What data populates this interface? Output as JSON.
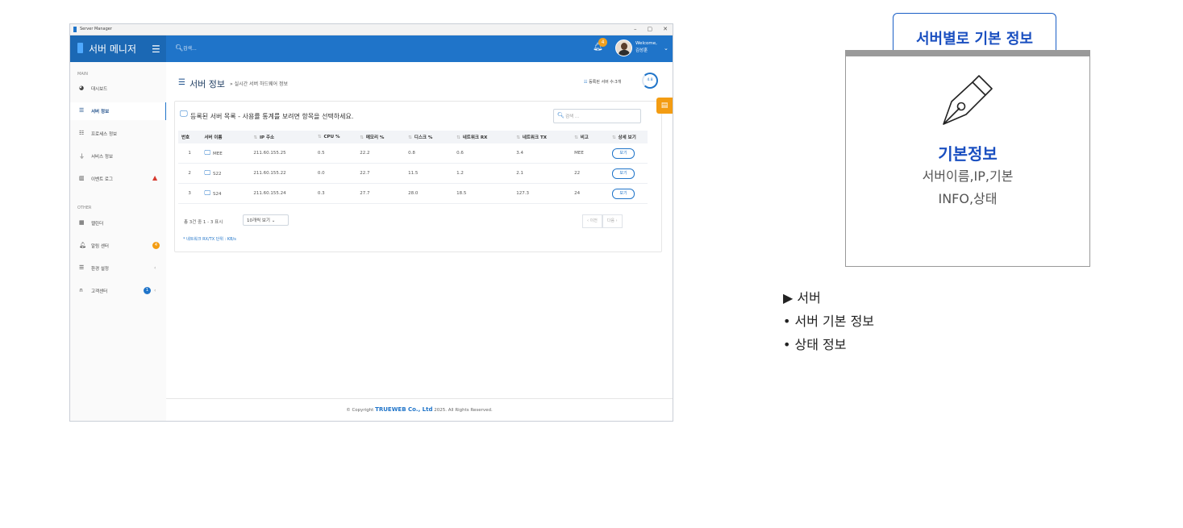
{
  "window": {
    "title": "Server Manager",
    "controls": [
      "–",
      "▢",
      "✕"
    ]
  },
  "topbar": {
    "brand": "서버 메니저",
    "search_placeholder": "검색...",
    "notif_count": "4",
    "welcome_line1": "Welcome,",
    "welcome_line2": "김성훈"
  },
  "sidebar": {
    "main_label": "MAIN",
    "other_label": "OTHER",
    "items": [
      {
        "label": "대시보드",
        "icon": "dashboard-icon"
      },
      {
        "label": "서버 정보",
        "icon": "server-icon"
      },
      {
        "label": "프로세스 정보",
        "icon": "list-icon"
      },
      {
        "label": "서비스 정보",
        "icon": "plug-icon"
      },
      {
        "label": "이벤트 로그",
        "icon": "trash-icon"
      },
      {
        "label": "캘린더",
        "icon": "calendar-icon"
      },
      {
        "label": "알림 센터",
        "icon": "bell-icon",
        "badge": "4"
      },
      {
        "label": "환경 설정",
        "icon": "sliders-icon"
      },
      {
        "label": "고객센터",
        "icon": "headset-icon",
        "badge": "1"
      }
    ]
  },
  "page": {
    "title": "서버 정보",
    "subtitle": "» 실시간 서버 하드웨어 정보",
    "server_count": "등록된 서버 수:3개",
    "ring_label": "4.8"
  },
  "card": {
    "title": "등록된 서버 목록 - 사용률 통계를 보려면 항목을 선택하세요.",
    "search_placeholder": "검색 ..."
  },
  "table": {
    "columns": [
      "번호",
      "서버 이름",
      "IP 주소",
      "CPU %",
      "메모리 %",
      "디스크 %",
      "네트워크 RX",
      "네트워크 TX",
      "비고",
      "상세 보기"
    ],
    "rows": [
      {
        "no": "1",
        "name": "MEE",
        "ip": "211.60.155.25",
        "cpu": "0.5",
        "mem": "22.2",
        "disk": "0.8",
        "rx": "0.6",
        "tx": "3.4",
        "note": "MEE",
        "action": "보기"
      },
      {
        "no": "2",
        "name": "S22",
        "ip": "211.60.155.22",
        "cpu": "0.0",
        "mem": "22.7",
        "disk": "11.5",
        "rx": "1.2",
        "tx": "2.1",
        "note": "22",
        "action": "보기"
      },
      {
        "no": "3",
        "name": "S24",
        "ip": "211.60.155.24",
        "cpu": "0.3",
        "mem": "27.7",
        "disk": "28.0",
        "rx": "18.5",
        "tx": "127.3",
        "note": "24",
        "action": "보기"
      }
    ]
  },
  "pagination": {
    "info": "총 3건 중 1 - 3 표시",
    "page_size": "10개씩 보기",
    "prev": "‹ 이전",
    "next": "다음 ›"
  },
  "unit_note": "* 네트워크 RX/TX 단위 : KB/s",
  "footer": {
    "prefix": "© Copyright",
    "company": "TRUEWEB Co., Ltd",
    "suffix": "2025. All Rights Reserved."
  },
  "info_card": {
    "tab_label": "서버별로 기본 정보",
    "title": "기본정보",
    "desc_line1": "서버이름,IP,기본",
    "desc_line2": "INFO,상태",
    "icon": "pen-nib-icon"
  },
  "bullets": {
    "heading": "▶ 서버",
    "items": [
      "• 서버 기본 정보",
      "• 상태 정보"
    ]
  },
  "colors": {
    "primary": "#1f74c9",
    "accent_title": "#1a4fc0",
    "warning": "#f39c12",
    "danger": "#d63a2f"
  }
}
